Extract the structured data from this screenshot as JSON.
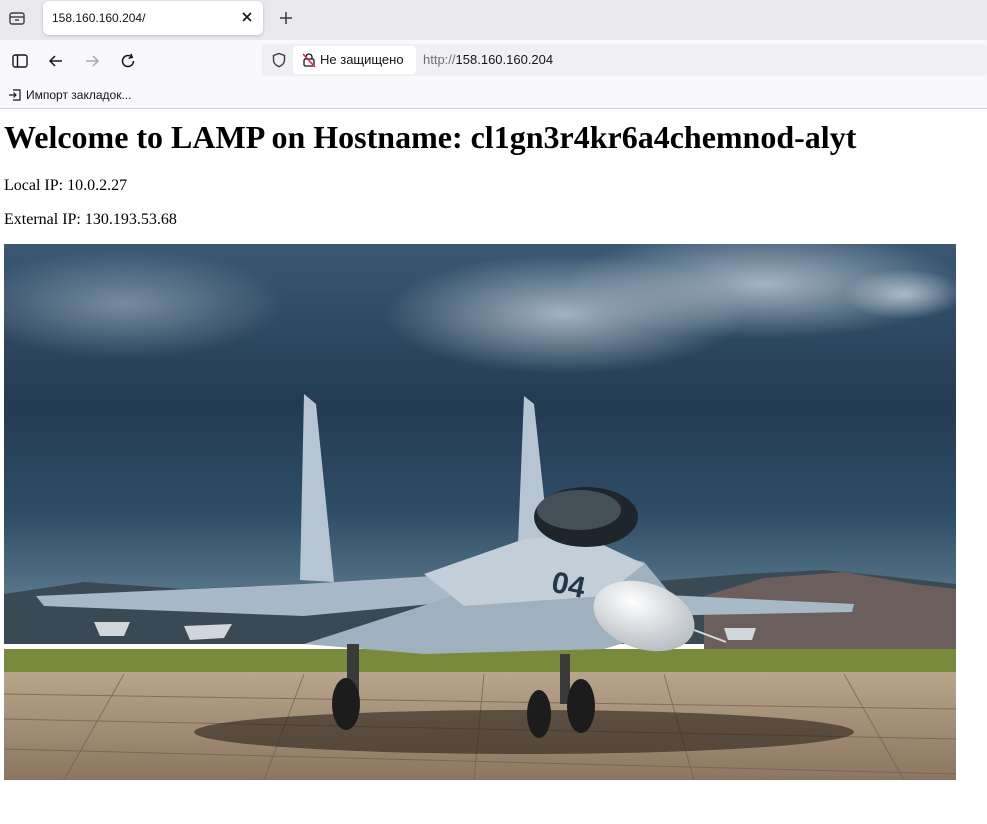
{
  "browser": {
    "tab": {
      "title": "158.160.160.204/"
    },
    "security_label": "Не защищено",
    "url_protocol": "http://",
    "url_host": "158.160.160.204",
    "bookmarks": [
      {
        "label": "Импорт закладок..."
      }
    ]
  },
  "page": {
    "heading": "Welcome to LAMP on Hostname: cl1gn3r4kr6a4chemnod-alyt",
    "local_ip": "Local IP: 10.0.2.27",
    "external_ip": "External IP: 130.193.53.68",
    "image_alt": "Su-30 fighter jet on runway"
  },
  "icons": [
    "tab-list-icon",
    "close-icon",
    "plus-icon",
    "sidebar-icon",
    "back-arrow-icon",
    "forward-arrow-icon",
    "reload-icon",
    "shield-icon",
    "insecure-lock-icon",
    "import-icon"
  ],
  "colors": {
    "tabbar": "#e8e8ed",
    "navbar": "#f9f9fb",
    "urlbar": "#f0f0f4",
    "insecure": "#e22850"
  }
}
